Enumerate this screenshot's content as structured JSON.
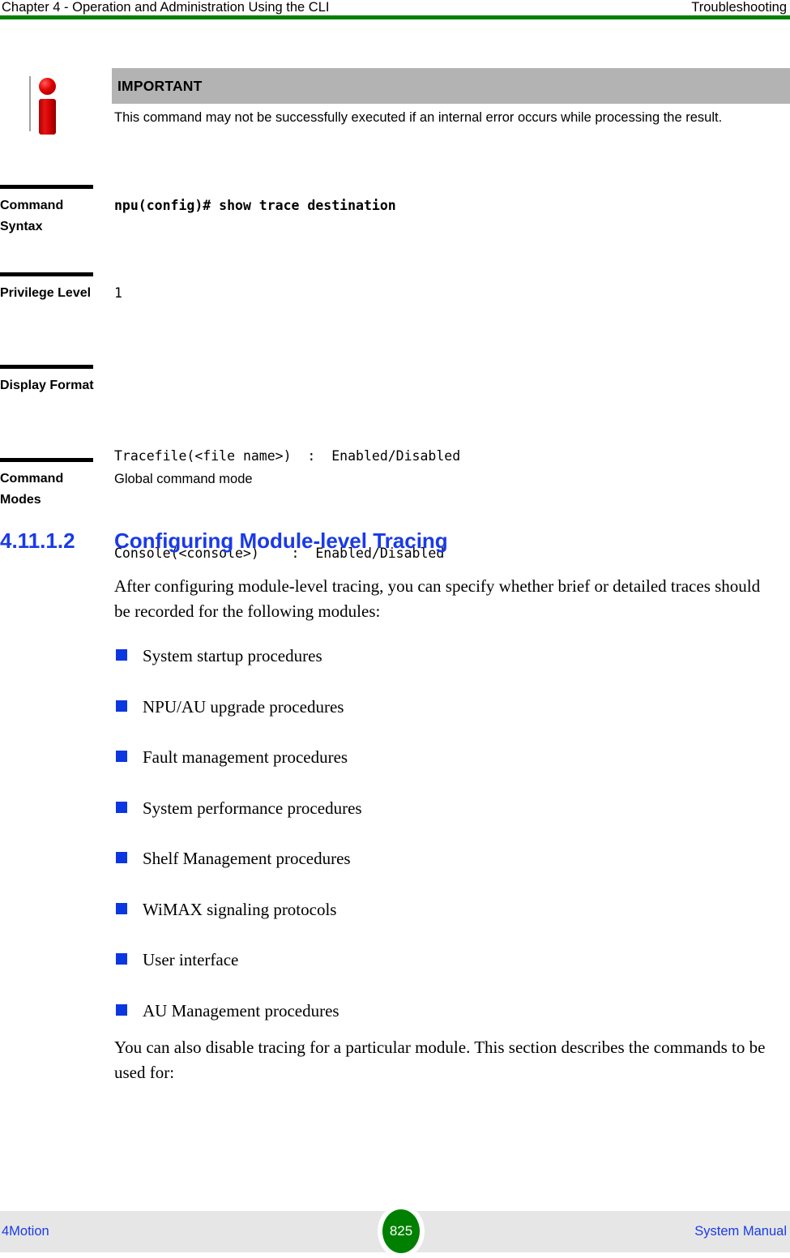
{
  "header": {
    "left": "Chapter 4 - Operation and Administration Using the CLI",
    "right": "Troubleshooting",
    "rule_color": "#008000"
  },
  "note": {
    "icon": "information-icon",
    "title": "IMPORTANT",
    "title_bar_color": "#b3b3b3",
    "body": "This command may not be successfully executed if an internal error occurs while processing the result."
  },
  "command_reference": {
    "rows": [
      {
        "label": "Command Syntax",
        "value": "npu(config)# show trace destination",
        "style": "mono-bold"
      },
      {
        "label": "Privilege Level",
        "value": "1",
        "style": "mono-plain"
      },
      {
        "label": "Display Format",
        "value_line_1": "Tracefile(<file name>)  :  Enabled/Disabled",
        "value_line_2": "Console(<console>)    :  Enabled/Disabled",
        "style": "mono-plain"
      },
      {
        "label": "Command Modes",
        "value": "Global command mode",
        "style": "sans"
      }
    ]
  },
  "section": {
    "number": "4.11.1.2",
    "title": "Configuring Module-level Tracing",
    "heading_color": "#1a3ae8",
    "intro_paragraph": "After configuring module-level tracing, you can specify whether brief or detailed traces should be recorded for the following modules:",
    "bullet_color": "#0b37e0",
    "bullets": [
      {
        "label": "System startup procedures"
      },
      {
        "label": "NPU/AU upgrade procedures"
      },
      {
        "label": "Fault management procedures"
      },
      {
        "label": "System performance procedures"
      },
      {
        "label": "Shelf Management procedures"
      },
      {
        "label": "WiMAX signaling protocols"
      },
      {
        "label": "User interface"
      },
      {
        "label": "AU Management procedures"
      }
    ],
    "closing_paragraph": "You can also disable tracing for a particular module. This section describes the commands to be used for:"
  },
  "footer": {
    "left": "4Motion",
    "page_number": "825",
    "right": "System Manual",
    "badge_color": "#008000",
    "bar_color": "#e6e6e6"
  }
}
